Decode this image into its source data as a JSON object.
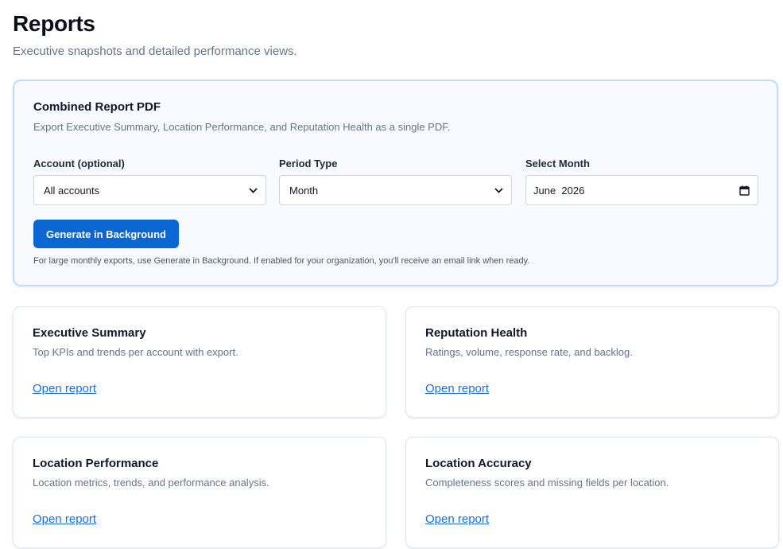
{
  "header": {
    "title": "Reports",
    "subtitle": "Executive snapshots and detailed performance views."
  },
  "combined": {
    "title": "Combined Report PDF",
    "description": "Export Executive Summary, Location Performance, and Reputation Health as a single PDF.",
    "account": {
      "label": "Account (optional)",
      "value": "All accounts"
    },
    "period": {
      "label": "Period Type",
      "value": "Month"
    },
    "month": {
      "label": "Select Month",
      "value": "June  2026"
    },
    "generate_label": "Generate in Background",
    "note": "For large monthly exports, use Generate in Background. If enabled for your organization, you'll receive an email link when ready."
  },
  "cards": [
    {
      "title": "Executive Summary",
      "description": "Top KPIs and trends per account with export.",
      "link": "Open report"
    },
    {
      "title": "Reputation Health",
      "description": "Ratings, volume, response rate, and backlog.",
      "link": "Open report"
    },
    {
      "title": "Location Performance",
      "description": "Location metrics, trends, and performance analysis.",
      "link": "Open report"
    },
    {
      "title": "Location Accuracy",
      "description": "Completeness scores and missing fields per location.",
      "link": "Open report"
    }
  ],
  "icons": {
    "select_chevron": "chevron-down-icon",
    "date_picker": "calendar-icon"
  },
  "colors": {
    "primary": "#0a66d1",
    "link": "#1d6fd8",
    "panel_border": "#bfdbfe",
    "panel_bg": "#f8faff"
  }
}
